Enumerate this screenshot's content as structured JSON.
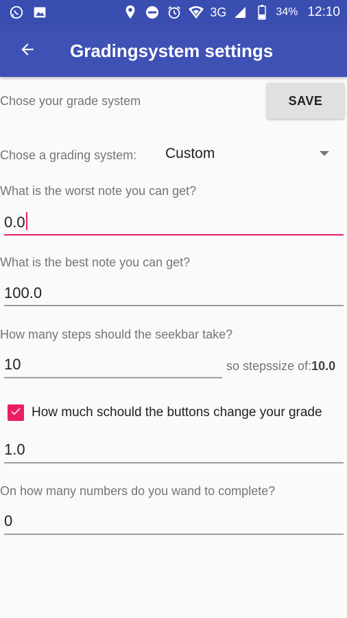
{
  "status_bar": {
    "network": "3G",
    "battery": "34%",
    "time": "12:10",
    "icons": [
      "whatsapp-icon",
      "image-icon",
      "location-icon",
      "do-not-disturb-icon",
      "alarm-icon",
      "wifi-icon",
      "signal-icon",
      "battery-icon"
    ]
  },
  "app_bar": {
    "title": "Gradingsystem settings",
    "back_icon": "arrow-back-icon"
  },
  "form": {
    "section_label": "Chose your grade system",
    "save_label": "SAVE",
    "grading_label": "Chose a grading system:",
    "grading_value": "Custom",
    "worst_label": "What is the worst note you can get?",
    "worst_value": "0.0",
    "best_label": "What is the best note you can get?",
    "best_value": "100.0",
    "steps_label": "How many steps should the seekbar take?",
    "steps_value": "10",
    "stepsize_prefix": "so stepssize of:",
    "stepsize_value": "10.0",
    "buttons_checkbox_label": "How much schould the buttons change your grade",
    "buttons_checked": true,
    "buttons_value": "1.0",
    "complete_label": "On how many numbers do you wand to complete?",
    "complete_value": "0"
  },
  "colors": {
    "primary": "#3f51b5",
    "primary_dark": "#3a4db0",
    "accent": "#e91e63"
  }
}
